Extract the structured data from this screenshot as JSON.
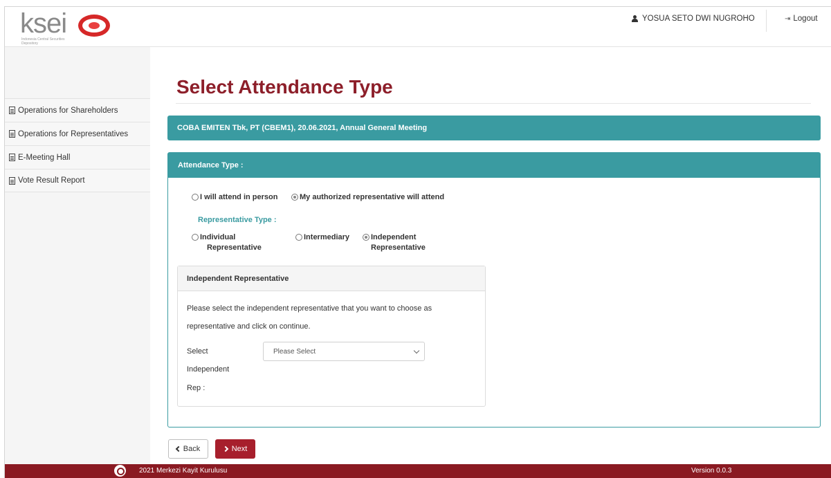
{
  "header": {
    "logo_text": "ksei",
    "logo_subtitle": "Indonesia Central Securities Depository",
    "user_name": "YOSUA SETO DWI NUGROHO",
    "logout_label": "Logout"
  },
  "sidebar": {
    "items": [
      {
        "label": "Operations for Shareholders"
      },
      {
        "label": "Operations for Representatives"
      },
      {
        "label": "E-Meeting Hall"
      },
      {
        "label": "Vote Result Report"
      }
    ]
  },
  "main": {
    "title": "Select Attendance Type",
    "meeting_info": "COBA EMITEN Tbk, PT (CBEM1), 20.06.2021, Annual General Meeting",
    "attendance_panel": {
      "header": "Attendance Type :",
      "options": [
        {
          "label": "I will attend in person",
          "checked": false
        },
        {
          "label": "My authorized representative will attend",
          "checked": true
        }
      ],
      "representative_type_label": "Representative Type :",
      "rep_options": [
        {
          "line1": "Individual",
          "line2": "Representative",
          "checked": false
        },
        {
          "line1": "Intermediary",
          "line2": "",
          "checked": false
        },
        {
          "line1": "Independent",
          "line2": "Representative",
          "checked": true
        }
      ]
    },
    "independent_panel": {
      "header": "Independent Representative",
      "instruction_line1": "Please select the independent representative that you want to choose as",
      "instruction_line2": "representative and click on continue.",
      "select_label_line1": "Select",
      "select_label_line2": "Independent",
      "select_label_line3": "Rep :",
      "select_value": "Please Select"
    },
    "buttons": {
      "back_label": "Back",
      "next_label": "Next"
    }
  },
  "footer": {
    "copyright": "2021 Merkezi Kayit Kurulusu",
    "version": "Version 0.0.3"
  },
  "colors": {
    "brand_red": "#8d1f2a",
    "teal": "#3a9ba1",
    "footer_bg": "#8a1a22",
    "next_button": "#a71f2c"
  }
}
